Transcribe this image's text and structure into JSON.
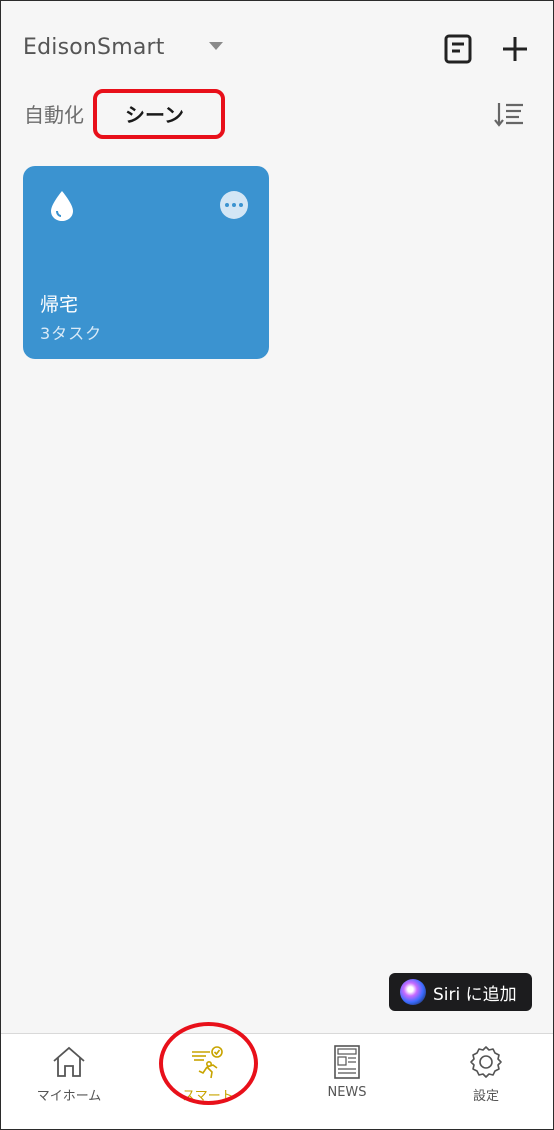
{
  "header": {
    "home_name": "EdisonSmart",
    "icons": {
      "dropdown": "caret-down-icon",
      "log": "document-icon",
      "add": "plus-icon"
    }
  },
  "tabs": [
    {
      "label": "自動化",
      "active": false
    },
    {
      "label": "シーン",
      "active": true
    }
  ],
  "sort_icon": "sort-icon",
  "scenes": [
    {
      "title": "帰宅",
      "subtitle": "3タスク",
      "icon": "water-drop-icon",
      "color": "#3b93d0"
    }
  ],
  "siri": {
    "label": "Siri に追加",
    "icon": "siri-icon"
  },
  "tabbar": {
    "items": [
      {
        "label": "マイホーム",
        "icon": "home-icon",
        "active": false
      },
      {
        "label": "スマート",
        "icon": "smart-icon",
        "active": true
      },
      {
        "label": "NEWS",
        "icon": "news-icon",
        "active": false
      },
      {
        "label": "設定",
        "icon": "gear-icon",
        "active": false
      }
    ],
    "active_color": "#c8a400"
  },
  "annotation_color": "#e8101a"
}
